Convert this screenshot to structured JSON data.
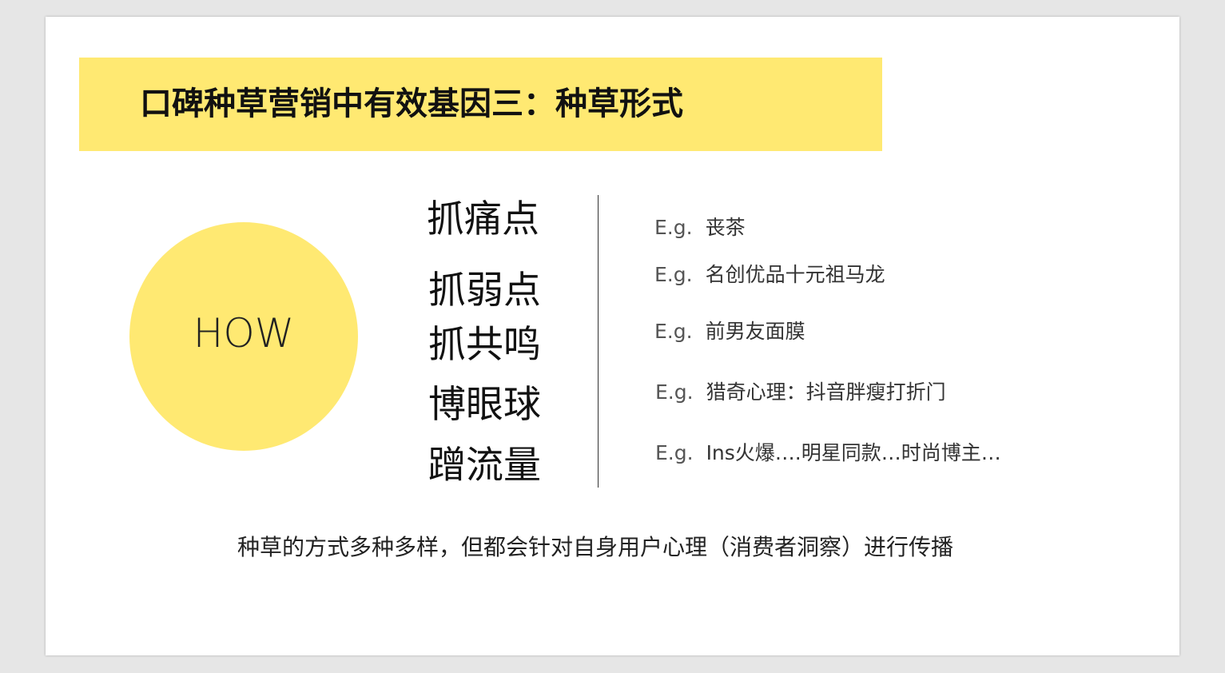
{
  "slide": {
    "title": "口碑种草营销中有效基因三：种草形式",
    "circle_label": "HOW",
    "methods": [
      "抓痛点",
      "抓弱点",
      "抓共鸣",
      "博眼球",
      "蹭流量"
    ],
    "examples": [
      {
        "prefix": "E.g.",
        "text": "丧茶"
      },
      {
        "prefix": "E.g.",
        "text": "名创优品十元祖马龙"
      },
      {
        "prefix": "E.g.",
        "text": "前男友面膜"
      },
      {
        "prefix": "E.g.",
        "text": "猎奇心理：抖音胖瘦打折门"
      },
      {
        "prefix": "E.g.",
        "text": "Ins火爆….明星同款…时尚博主…"
      }
    ],
    "summary": "种草的方式多种多样，但都会针对自身用户心理（消费者洞察）进行传播"
  },
  "colors": {
    "accent": "#ffe972",
    "background": "#ffffff",
    "canvas": "#e6e6e6"
  }
}
